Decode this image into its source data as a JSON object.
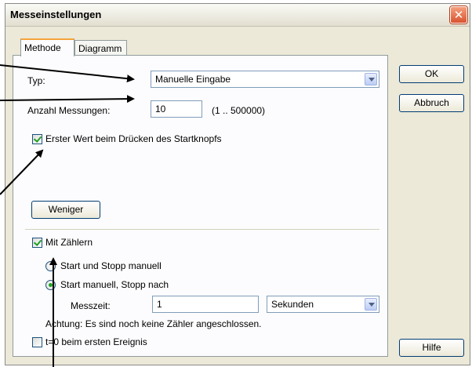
{
  "window": {
    "title": "Messeinstellungen",
    "close_glyph": "✕"
  },
  "tabs": [
    {
      "label": "Methode",
      "active": true
    },
    {
      "label": "Diagramm",
      "active": false
    }
  ],
  "methode": {
    "typ_label": "Typ:",
    "typ_value": "Manuelle Eingabe",
    "anzahl_label": "Anzahl Messungen:",
    "anzahl_value": "10",
    "anzahl_range": "(1 .. 500000)",
    "erster_wert_label": "Erster Wert beim Drücken des Startknopfs",
    "erster_wert_checked": true,
    "weniger_label": "Weniger"
  },
  "zaehler": {
    "mit_zaehlern_label": "Mit Zählern",
    "mit_zaehlern_checked": true,
    "radio_manual_label": "Start und Stopp manuell",
    "radio_after_label": "Start manuell, Stopp nach",
    "selected_radio": "radio_after",
    "messzeit_label": "Messzeit:",
    "messzeit_value": "1",
    "unit_value": "Sekunden",
    "warning": "Achtung: Es sind noch keine Zähler angeschlossen.",
    "t0_label": "t=0 beim ersten Ereignis",
    "t0_checked": false
  },
  "buttons": {
    "ok": "OK",
    "abbruch": "Abbruch",
    "hilfe": "Hilfe"
  },
  "colors": {
    "arrow": "#000000",
    "check_green": "#21a121",
    "close_red": "#d9532f",
    "tab_accent": "#f4a43a"
  }
}
